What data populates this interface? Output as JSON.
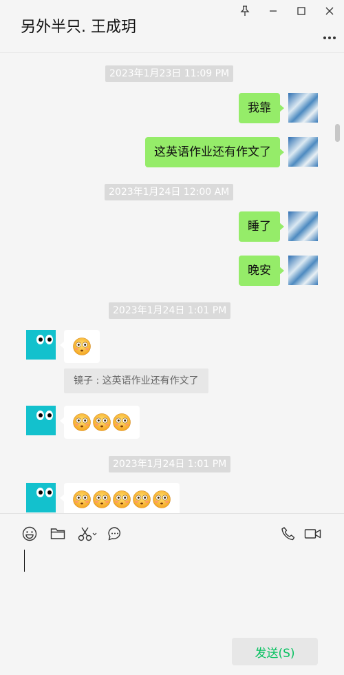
{
  "window": {
    "title": "另外半只. 王成玥",
    "pin_icon": "pin-icon",
    "minimize_icon": "minimize-icon",
    "maximize_icon": "maximize-icon",
    "close_icon": "close-icon",
    "more_icon": "more-icon"
  },
  "chat": {
    "timestamps": [
      "2023年1月23日 11:09 PM",
      "2023年1月24日 12:00 AM",
      "2023年1月24日 1:01 PM",
      "2023年1月24日 1:01 PM"
    ],
    "sent_messages": [
      "我靠",
      "这英语作业还有作文了",
      "睡了",
      "晚安"
    ],
    "received": [
      {
        "emoji_count": 1
      },
      {
        "emoji_count": 3
      },
      {
        "emoji_count": 5
      }
    ],
    "quote_text": "镜子 : 这英语作业还有作文了",
    "emoji_name": "flushed-face-emoji"
  },
  "toolbar": {
    "icons": [
      "emoji-icon",
      "folder-icon",
      "scissors-icon",
      "chat-bubble-icon",
      "phone-icon",
      "video-icon"
    ],
    "send_label": "发送(S)"
  },
  "colors": {
    "sent_bubble": "#95ec69",
    "received_bubble": "#ffffff",
    "avatar_teal": "#13c1cd",
    "send_text": "#07c160",
    "background": "#f5f5f5"
  }
}
